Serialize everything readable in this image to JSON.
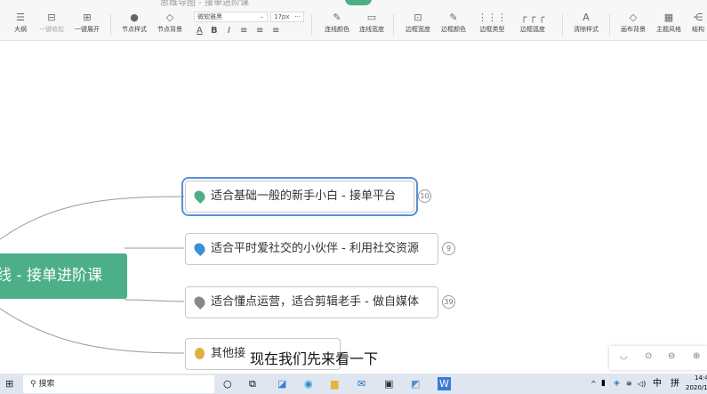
{
  "window": {
    "title": "思维导图 - 接单进阶课"
  },
  "toolbar": {
    "outline": "大纲",
    "collapse_all": "一键收起",
    "expand_all": "一键展开",
    "node_style": "节点样式",
    "node_bg": "节点背景",
    "font_family": "微软雅黑",
    "font_size": "17px",
    "bold": "B",
    "italic": "I",
    "underline": "A",
    "line_color": "连线颜色",
    "line_width": "连线宽度",
    "border_width": "边框宽度",
    "border_color": "边框颜色",
    "border_type": "边框类型",
    "border_radius": "边框弧度",
    "clear_style": "清除样式",
    "canvas_bg": "画布背景",
    "theme": "主题风格",
    "structure": "结构"
  },
  "mindmap": {
    "root": "线 - 接单进阶课",
    "nodes": [
      {
        "label": "适合基础一般的新手小白 - 接单平台",
        "count": "10",
        "color": "#4caf87"
      },
      {
        "label": "适合平时爱社交的小伙伴 - 利用社交资源",
        "count": "9",
        "color": "#3b8fd9"
      },
      {
        "label": "适合懂点运营，适合剪辑老手 - 做自媒体",
        "count": "39",
        "color": "#888888"
      },
      {
        "label": "其他接",
        "count": "",
        "color": "#e0b040"
      }
    ]
  },
  "subtitle": "现在我们先来看一下",
  "taskbar": {
    "search_placeholder": "搜索",
    "ime": "中",
    "ime2": "拼",
    "time": "14:4",
    "date": "2020/1"
  }
}
